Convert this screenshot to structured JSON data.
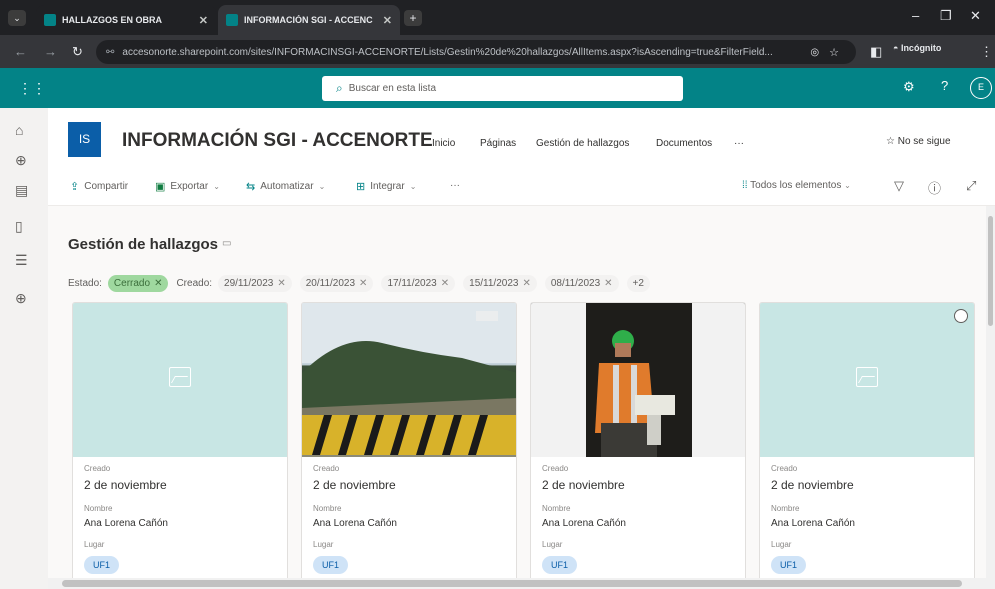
{
  "browser": {
    "tabs": [
      {
        "label": "HALLAZGOS EN OBRA",
        "active": false
      },
      {
        "label": "INFORMACIÓN SGI - ACCENC",
        "active": true
      }
    ],
    "url": "accesonorte.sharepoint.com/sites/INFORMACINSGI-ACCENORTE/Lists/Gestin%20de%20hallazgos/AllItems.aspx?isAscending=true&FilterField...",
    "incognito_label": "Incógnito"
  },
  "suite": {
    "search_placeholder": "Buscar en esta lista",
    "avatar_initial": "E",
    "accent_color": "#038387"
  },
  "site": {
    "logo_text": "IS",
    "title": "INFORMACIÓN SGI - ACCENORTE",
    "nav": [
      "Inicio",
      "Páginas",
      "Gestión de hallazgos",
      "Documentos",
      "···"
    ],
    "follow_label": "No se sigue"
  },
  "commands": {
    "share": "Compartir",
    "export": "Exportar",
    "automate": "Automatizar",
    "integrate": "Integrar",
    "more": "···",
    "view": "Todos los elementos"
  },
  "list": {
    "title": "Gestión de hallazgos",
    "filter_state_label": "Estado:",
    "filter_state_value": "Cerrado",
    "filter_created_label": "Creado:",
    "filter_dates": [
      "29/11/2023",
      "20/11/2023",
      "17/11/2023",
      "15/11/2023",
      "08/11/2023"
    ],
    "filter_more": "+2"
  },
  "cards": [
    {
      "created_label": "Creado",
      "created": "2 de noviembre",
      "name_label": "Nombre",
      "name": "Ana Lorena Cañón",
      "place_label": "Lugar",
      "place": "UF1",
      "image": "placeholder"
    },
    {
      "created_label": "Creado",
      "created": "2 de noviembre",
      "name_label": "Nombre",
      "name": "Ana Lorena Cañón",
      "place_label": "Lugar",
      "place": "UF1",
      "image": "road-photo"
    },
    {
      "created_label": "Creado",
      "created": "2 de noviembre",
      "name_label": "Nombre",
      "name": "Ana Lorena Cañón",
      "place_label": "Lugar",
      "place": "UF1",
      "image": "worker-photo"
    },
    {
      "created_label": "Creado",
      "created": "2 de noviembre",
      "name_label": "Nombre",
      "name": "Ana Lorena Cañón",
      "place_label": "Lugar",
      "place": "UF1",
      "image": "placeholder"
    }
  ]
}
